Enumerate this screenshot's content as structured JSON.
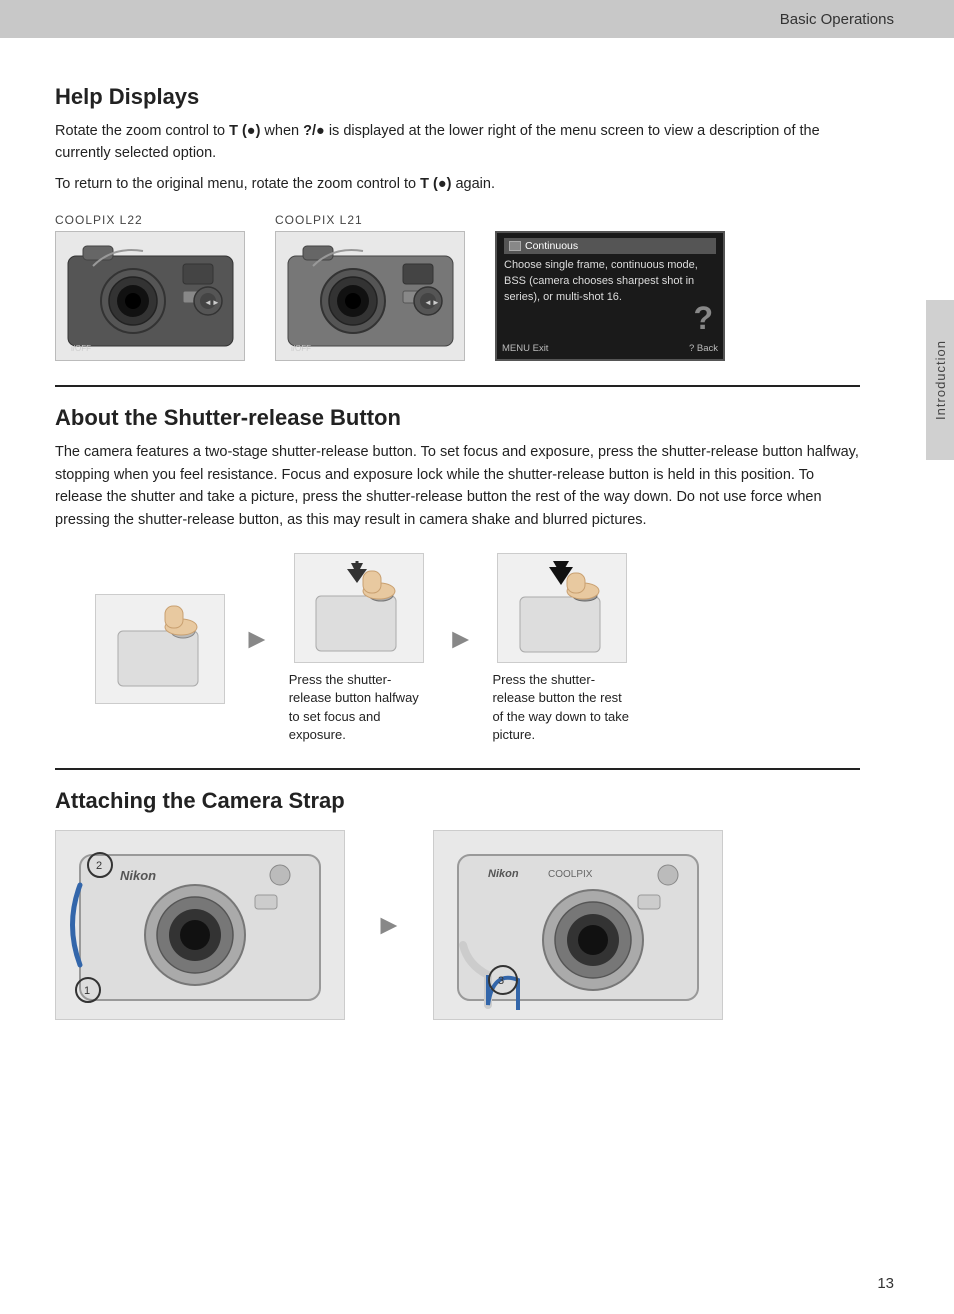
{
  "header": {
    "title": "Basic Operations"
  },
  "side_tab": {
    "label": "Introduction"
  },
  "help_displays": {
    "title": "Help Displays",
    "para1_text": "Rotate the zoom control to ",
    "para1_T": "T",
    "para1_mid": ") when ",
    "para1_symbol": "?/●",
    "para1_end": " is displayed at the lower right of the menu screen to view a description of the currently selected option.",
    "para2": "To return to the original menu, rotate the zoom control to ",
    "para2_T": "T",
    "para2_end": ") again.",
    "cam1_label": "COOLPIX L22",
    "cam2_label": "COOLPIX L21",
    "screen_header": "Continuous",
    "screen_text": "Choose single frame, continuous mode, BSS (camera chooses sharpest shot in series), or multi-shot 16.",
    "screen_footer_left": "MENU Exit",
    "screen_footer_right": "? Back"
  },
  "shutter_release": {
    "title": "About the Shutter-release Button",
    "para": "The camera features a two-stage shutter-release button. To set focus and exposure, press the shutter-release button halfway, stopping when you feel resistance. Focus and exposure lock while the shutter-release button is held in this position. To release the shutter and take a picture, press the shutter-release button the rest of the way down. Do not use force when pressing the shutter-release button, as this may result in camera shake and blurred pictures.",
    "caption1": "Press the shutter-release button halfway to set focus and exposure.",
    "caption2": "Press the shutter-release button the rest of the way down to take picture."
  },
  "strap": {
    "title": "Attaching the Camera Strap"
  },
  "page_number": "13"
}
